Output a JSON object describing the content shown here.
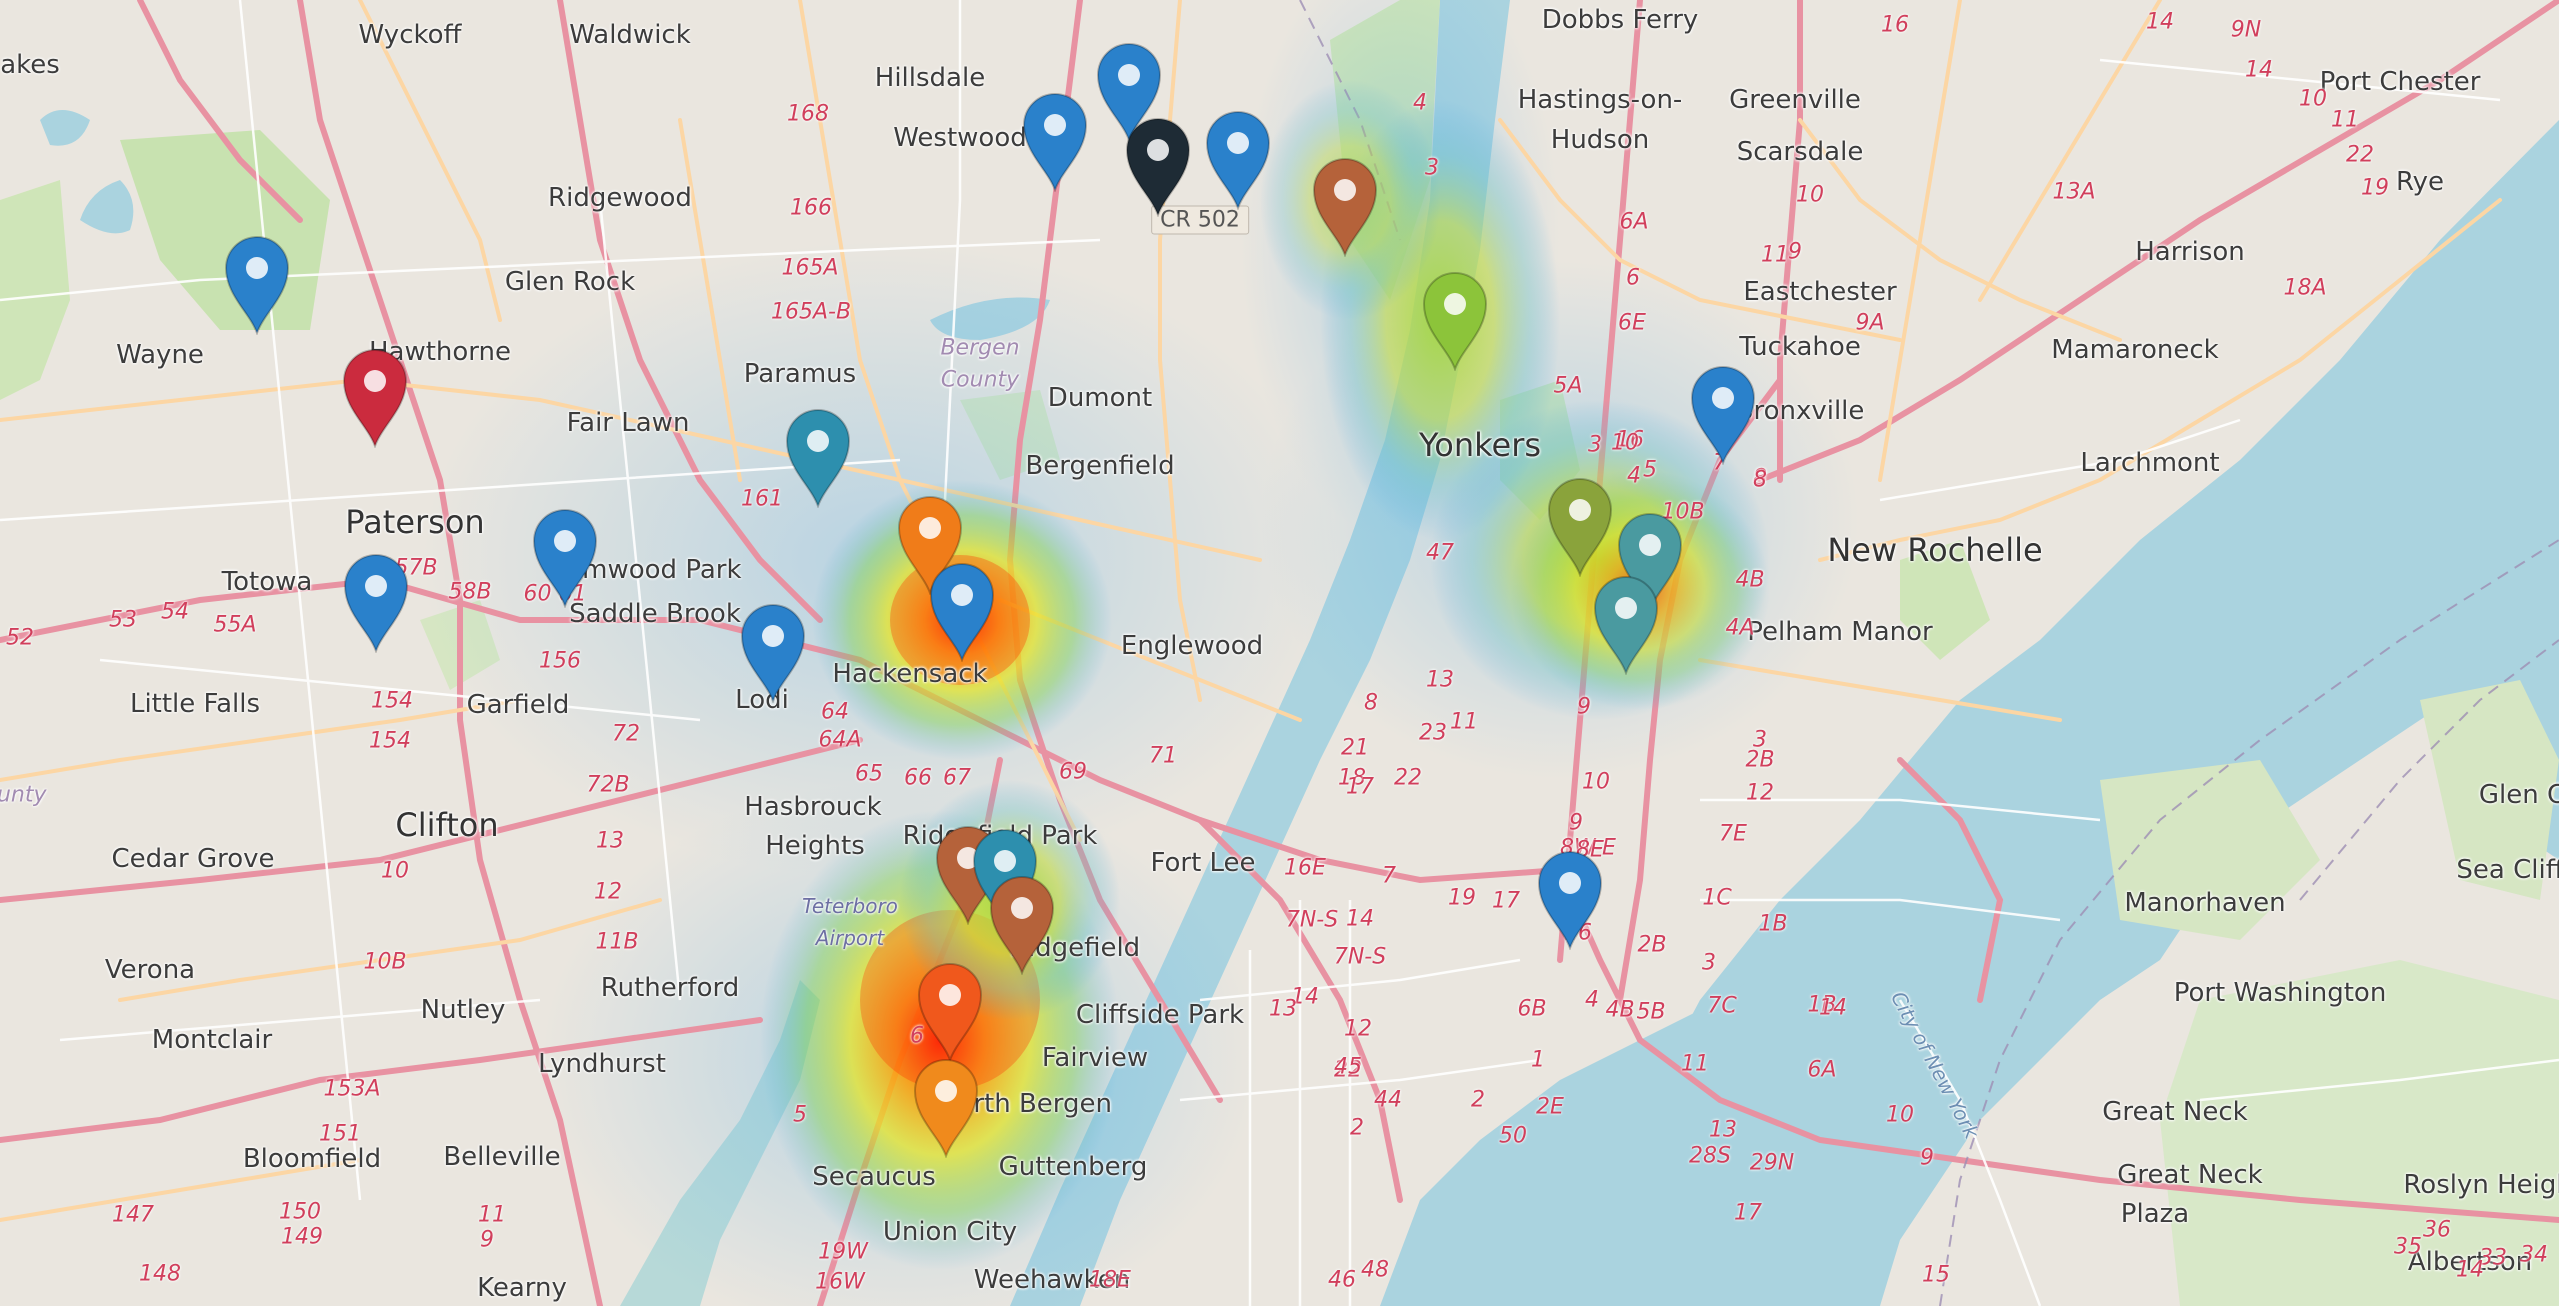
{
  "map": {
    "colors": {
      "land": "#eae6df",
      "water": "#aad3df",
      "park": "#c8e2b0",
      "motorway": "#e892a2",
      "primary": "#fcd6a4",
      "road": "#ffffff"
    },
    "place_labels": [
      {
        "text": "Wyckoff",
        "kind": "town",
        "name": "label-wyckoff"
      },
      {
        "text": "Waldwick",
        "kind": "town",
        "name": "label-waldwick"
      },
      {
        "text": "Hillsdale",
        "kind": "town",
        "name": "label-hillsdale"
      },
      {
        "text": "Westwood",
        "kind": "town",
        "name": "label-westwood"
      },
      {
        "text": "Dobbs Ferry",
        "kind": "town",
        "name": "label-dobbs-ferry"
      },
      {
        "text": "Hastings-on-",
        "kind": "town",
        "name": "label-hastings-1"
      },
      {
        "text": "Hudson",
        "kind": "town",
        "name": "label-hastings-2"
      },
      {
        "text": "Greenville",
        "kind": "town",
        "name": "label-greenville"
      },
      {
        "text": "Scarsdale",
        "kind": "town",
        "name": "label-scarsdale"
      },
      {
        "text": "Port Chester",
        "kind": "town",
        "name": "label-port-chester"
      },
      {
        "text": "Rye",
        "kind": "town",
        "name": "label-rye"
      },
      {
        "text": "Harrison",
        "kind": "town",
        "name": "label-harrison"
      },
      {
        "text": "akes",
        "kind": "town",
        "name": "label-lakes"
      },
      {
        "text": "Ridgewood",
        "kind": "town",
        "name": "label-ridgewood"
      },
      {
        "text": "Glen Rock",
        "kind": "town",
        "name": "label-glen-rock"
      },
      {
        "text": "Wayne",
        "kind": "town",
        "name": "label-wayne"
      },
      {
        "text": "Hawthorne",
        "kind": "town",
        "name": "label-hawthorne"
      },
      {
        "text": "Paramus",
        "kind": "town",
        "name": "label-paramus"
      },
      {
        "text": "Fair Lawn",
        "kind": "town",
        "name": "label-fair-lawn"
      },
      {
        "text": "Bergen",
        "kind": "county",
        "name": "label-bergen-county-1"
      },
      {
        "text": "County",
        "kind": "county",
        "name": "label-bergen-county-2"
      },
      {
        "text": "Dumont",
        "kind": "town",
        "name": "label-dumont"
      },
      {
        "text": "Bergenfield",
        "kind": "town",
        "name": "label-bergenfield"
      },
      {
        "text": "Eastchester",
        "kind": "town",
        "name": "label-eastchester"
      },
      {
        "text": "Tuckahoe",
        "kind": "town",
        "name": "label-tuckahoe"
      },
      {
        "text": "Bronxville",
        "kind": "town",
        "name": "label-bronxville"
      },
      {
        "text": "Mamaroneck",
        "kind": "town",
        "name": "label-mamaroneck"
      },
      {
        "text": "Larchmont",
        "kind": "town",
        "name": "label-larchmont"
      },
      {
        "text": "Yonkers",
        "kind": "city",
        "name": "label-yonkers"
      },
      {
        "text": "New Rochelle",
        "kind": "city",
        "name": "label-new-rochelle"
      },
      {
        "text": "Pelham Manor",
        "kind": "town",
        "name": "label-pelham-manor"
      },
      {
        "text": "Paterson",
        "kind": "city",
        "name": "label-paterson"
      },
      {
        "text": "Totowa",
        "kind": "town",
        "name": "label-totowa"
      },
      {
        "text": "Elmwood Park",
        "kind": "town",
        "name": "label-elmwood-park"
      },
      {
        "text": "Saddle Brook",
        "kind": "town",
        "name": "label-saddle-brook"
      },
      {
        "text": "Hackensack",
        "kind": "town",
        "name": "label-hackensack"
      },
      {
        "text": "Englewood",
        "kind": "town",
        "name": "label-englewood"
      },
      {
        "text": "Little Falls",
        "kind": "town",
        "name": "label-little-falls"
      },
      {
        "text": "Garfield",
        "kind": "town",
        "name": "label-garfield"
      },
      {
        "text": "Lodi",
        "kind": "town",
        "name": "label-lodi"
      },
      {
        "text": "Clifton",
        "kind": "city",
        "name": "label-clifton"
      },
      {
        "text": "Hasbrouck",
        "kind": "town",
        "name": "label-hasbrouck-1"
      },
      {
        "text": "Heights",
        "kind": "town",
        "name": "label-hasbrouck-2"
      },
      {
        "text": "Ridgefield Park",
        "kind": "town",
        "name": "label-ridgefield-park"
      },
      {
        "text": "Fort Lee",
        "kind": "town",
        "name": "label-fort-lee"
      },
      {
        "text": "Cedar Grove",
        "kind": "town",
        "name": "label-cedar-grove"
      },
      {
        "text": "Teterboro",
        "kind": "airport",
        "name": "label-teterboro-1"
      },
      {
        "text": "Airport",
        "kind": "airport",
        "name": "label-teterboro-2"
      },
      {
        "text": "Ridgefield",
        "kind": "town",
        "name": "label-ridgefield"
      },
      {
        "text": "Verona",
        "kind": "town",
        "name": "label-verona"
      },
      {
        "text": "Rutherford",
        "kind": "town",
        "name": "label-rutherford"
      },
      {
        "text": "Nutley",
        "kind": "town",
        "name": "label-nutley"
      },
      {
        "text": "Cliffside Park",
        "kind": "town",
        "name": "label-cliffside-park"
      },
      {
        "text": "Fairview",
        "kind": "town",
        "name": "label-fairview"
      },
      {
        "text": "Montclair",
        "kind": "town",
        "name": "label-montclair"
      },
      {
        "text": "Lyndhurst",
        "kind": "town",
        "name": "label-lyndhurst"
      },
      {
        "text": "North Bergen",
        "kind": "town",
        "name": "label-north-bergen"
      },
      {
        "text": "Bloomfield",
        "kind": "town",
        "name": "label-bloomfield"
      },
      {
        "text": "Belleville",
        "kind": "town",
        "name": "label-belleville"
      },
      {
        "text": "Secaucus",
        "kind": "town",
        "name": "label-secaucus"
      },
      {
        "text": "Guttenberg",
        "kind": "town",
        "name": "label-guttenberg"
      },
      {
        "text": "Union City",
        "kind": "town",
        "name": "label-union-city"
      },
      {
        "text": "Kearny",
        "kind": "town",
        "name": "label-kearny"
      },
      {
        "text": "Weehawken",
        "kind": "town",
        "name": "label-weehawken"
      },
      {
        "text": "Glen Co",
        "kind": "town",
        "name": "label-glen-cove"
      },
      {
        "text": "Sea Cliff",
        "kind": "town",
        "name": "label-sea-cliff"
      },
      {
        "text": "Manorhaven",
        "kind": "town",
        "name": "label-manorhaven"
      },
      {
        "text": "Port Washington",
        "kind": "town",
        "name": "label-port-washington"
      },
      {
        "text": "Great Neck",
        "kind": "town",
        "name": "label-great-neck"
      },
      {
        "text": "Great Neck",
        "kind": "town",
        "name": "label-great-neck-plaza-1"
      },
      {
        "text": "Plaza",
        "kind": "town",
        "name": "label-great-neck-plaza-2"
      },
      {
        "text": "Roslyn Heights",
        "kind": "town",
        "name": "label-roslyn-heights"
      },
      {
        "text": "Albertson",
        "kind": "town",
        "name": "label-albertson"
      },
      {
        "text": "City of New York",
        "kind": "water",
        "name": "label-city-of-new-york"
      },
      {
        "text": "ounty",
        "kind": "county",
        "name": "label-county-edge"
      }
    ],
    "road_label": {
      "text": "CR 502"
    },
    "route_shields": [
      "16",
      "14",
      "14",
      "9N",
      "10",
      "11",
      "22",
      "13A",
      "168",
      "166",
      "165A",
      "165A-B",
      "19",
      "18A",
      "11",
      "4",
      "3",
      "6A",
      "6",
      "6E",
      "9A",
      "10",
      "9",
      "5A",
      "7",
      "8",
      "16",
      "8",
      "10",
      "3",
      "4",
      "5",
      "10B",
      "9",
      "161",
      "57B",
      "58B",
      "60 61",
      "53",
      "54",
      "55A",
      "52",
      "156",
      "154",
      "154",
      "64",
      "64A",
      "65",
      "66",
      "67",
      "69",
      "71",
      "72",
      "72B",
      "13",
      "12",
      "11B",
      "10",
      "10B",
      "153A",
      "151",
      "150",
      "149",
      "148",
      "147",
      "11",
      "9",
      "6",
      "5",
      "19W",
      "16W",
      "18E",
      "16E",
      "7",
      "14",
      "7N-S",
      "7N-S",
      "14",
      "13",
      "12",
      "22",
      "19",
      "17",
      "16",
      "2B",
      "3",
      "4",
      "4B",
      "5B",
      "6B",
      "1",
      "2E",
      "50",
      "48",
      "46",
      "45",
      "44",
      "2",
      "2",
      "47",
      "8",
      "21",
      "18",
      "17",
      "22",
      "23",
      "11",
      "13",
      "10",
      "9",
      "8W-E",
      "8E",
      "7E",
      "1C",
      "1B",
      "1B",
      "7C",
      "11",
      "10",
      "9",
      "8",
      "33",
      "34",
      "35",
      "36",
      "28S",
      "29N",
      "17",
      "15",
      "14",
      "6A",
      "13",
      "14",
      "12",
      "2B",
      "3",
      "4A",
      "4B",
      "5A",
      "2",
      "3"
    ],
    "markers": [
      {
        "name": "map-marker-blue-1",
        "color": "#2a81cb",
        "tooltip": ""
      },
      {
        "name": "map-marker-blue-2",
        "color": "#2a81cb",
        "tooltip": ""
      },
      {
        "name": "map-marker-black",
        "color": "#1e2b35",
        "tooltip": ""
      },
      {
        "name": "map-marker-blue-3",
        "color": "#2a81cb",
        "tooltip": ""
      },
      {
        "name": "map-marker-brown-1",
        "color": "#b5623a",
        "tooltip": ""
      },
      {
        "name": "map-marker-green",
        "color": "#8cc43a",
        "tooltip": ""
      },
      {
        "name": "map-marker-blue-4",
        "color": "#2a81cb",
        "tooltip": ""
      },
      {
        "name": "map-marker-red",
        "color": "#cb2b3e",
        "tooltip": ""
      },
      {
        "name": "map-marker-blue-5",
        "color": "#2a81cb",
        "tooltip": ""
      },
      {
        "name": "map-marker-teal-1",
        "color": "#2d8fae",
        "tooltip": ""
      },
      {
        "name": "map-marker-orange-1",
        "color": "#f07c19",
        "tooltip": ""
      },
      {
        "name": "map-marker-blue-6",
        "color": "#2a81cb",
        "tooltip": ""
      },
      {
        "name": "map-marker-blue-7",
        "color": "#2a81cb",
        "tooltip": ""
      },
      {
        "name": "map-marker-blue-8",
        "color": "#2a81cb",
        "tooltip": ""
      },
      {
        "name": "map-marker-blue-9",
        "color": "#2a81cb",
        "tooltip": ""
      },
      {
        "name": "map-marker-olive",
        "color": "#8aa33b",
        "tooltip": ""
      },
      {
        "name": "map-marker-teal-2",
        "color": "#4a9aa0",
        "tooltip": ""
      },
      {
        "name": "map-marker-teal-3",
        "color": "#4a9aa0",
        "tooltip": ""
      },
      {
        "name": "map-marker-brown-2",
        "color": "#b5623a",
        "tooltip": ""
      },
      {
        "name": "map-marker-teal-4",
        "color": "#2d8fae",
        "tooltip": ""
      },
      {
        "name": "map-marker-brown-3",
        "color": "#b5623a",
        "tooltip": ""
      },
      {
        "name": "map-marker-orange-red",
        "color": "#f0581c",
        "tooltip": ""
      },
      {
        "name": "map-marker-orange-2",
        "color": "#f08a1c",
        "tooltip": ""
      },
      {
        "name": "map-marker-blue-10",
        "color": "#2a81cb",
        "tooltip": ""
      }
    ],
    "heat_spots": [
      {
        "name": "heat-hackensack",
        "intensity": 0.9
      },
      {
        "name": "heat-yonkers",
        "intensity": 0.55
      },
      {
        "name": "heat-mount-vernon",
        "intensity": 0.7
      },
      {
        "name": "heat-north-bergen",
        "intensity": 1.0
      },
      {
        "name": "heat-ridgefield",
        "intensity": 0.6
      },
      {
        "name": "heat-alpine",
        "intensity": 0.35
      }
    ]
  }
}
